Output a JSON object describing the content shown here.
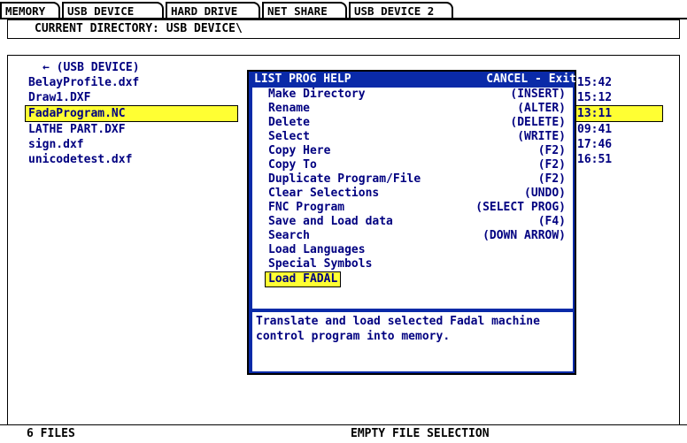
{
  "tabs": [
    "MEMORY",
    "USB DEVICE",
    "HARD DRIVE",
    "NET SHARE",
    "USB DEVICE 2"
  ],
  "current_directory": "CURRENT DIRECTORY: USB DEVICE\\",
  "files": [
    {
      "name": "← (USB DEVICE)",
      "time": ""
    },
    {
      "name": "BelayProfile.dxf",
      "time": "15:42"
    },
    {
      "name": "Draw1.DXF",
      "time": "15:12"
    },
    {
      "name": "FadaProgram.NC",
      "time": "13:11",
      "selected": true
    },
    {
      "name": "LATHE PART.DXF",
      "time": "09:41"
    },
    {
      "name": "sign.dxf",
      "time": "17:46"
    },
    {
      "name": "unicodetest.dxf",
      "time": "16:51"
    }
  ],
  "status": {
    "files_count": "6 FILES",
    "selection": "EMPTY FILE SELECTION"
  },
  "dialog": {
    "title": "LIST PROG HELP",
    "cancel": "CANCEL - Exit",
    "items": [
      {
        "label": "Make Directory",
        "key": "(INSERT)"
      },
      {
        "label": "Rename",
        "key": "(ALTER)"
      },
      {
        "label": "Delete",
        "key": "(DELETE)"
      },
      {
        "label": "Select",
        "key": "(WRITE)"
      },
      {
        "label": "Copy Here",
        "key": "(F2)"
      },
      {
        "label": "Copy To",
        "key": "(F2)"
      },
      {
        "label": "Duplicate Program/File",
        "key": "(F2)"
      },
      {
        "label": "Clear Selections",
        "key": "(UNDO)"
      },
      {
        "label": "FNC Program",
        "key": "(SELECT PROG)"
      },
      {
        "label": "Save and Load data",
        "key": "(F4)"
      },
      {
        "label": "Search",
        "key": "(DOWN ARROW)"
      },
      {
        "label": "Load Languages",
        "key": ""
      },
      {
        "label": "Special Symbols",
        "key": ""
      },
      {
        "label": "Load FADAL",
        "key": "",
        "selected": true
      }
    ],
    "description": "Translate and load selected Fadal machine control program into memory."
  },
  "colors": {
    "highlight": "#ffff33",
    "dialog_frame": "#0a2aa8",
    "text_blue": "#000080"
  }
}
